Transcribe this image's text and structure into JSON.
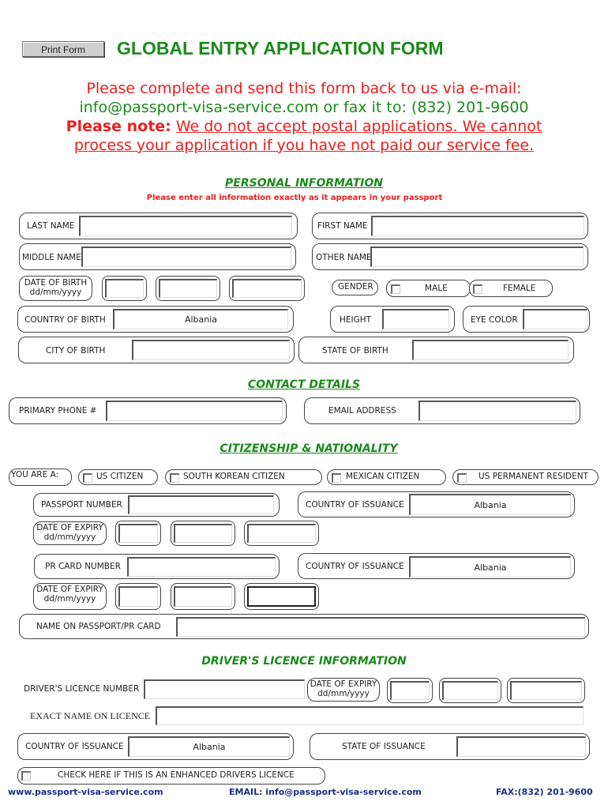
{
  "header": {
    "print_button": "Print Form",
    "title": "GLOBAL ENTRY APPLICATION FORM"
  },
  "notice": {
    "line1": "Please complete and send this form back to us via e-mail:",
    "line2": "info@passport-visa-service.com or fax it to:  (832) 201-9600",
    "note_label": "Please note:",
    "note_text_a": "We do not accept postal applications. We cannot",
    "note_text_b": "process your application if you have not paid our service fee."
  },
  "personal": {
    "title": "PERSONAL INFORMATION",
    "note": "Please enter all information exactly as it appears in your passport",
    "last_name": "LAST NAME",
    "first_name": "FIRST NAME",
    "middle_name": "MIDDLE NAME",
    "other_name": "OTHER NAME",
    "dob_line1": "DATE OF BIRTH",
    "dob_line2": "dd/mm/yyyy",
    "gender": "GENDER",
    "male": "MALE",
    "female": "FEMALE",
    "country_of_birth": "COUNTRY OF BIRTH",
    "country_of_birth_value": "Albania",
    "height": "HEIGHT",
    "eye_color": "EYE COLOR",
    "city_of_birth": "CITY OF BIRTH",
    "state_of_birth": "STATE OF BIRTH"
  },
  "contact": {
    "title": "CONTACT DETAILS",
    "phone": "PRIMARY PHONE #",
    "email": "EMAIL ADDRESS"
  },
  "citizenship": {
    "title": "CITIZENSHIP & NATIONALITY",
    "you_are": "YOU ARE A:",
    "options": [
      "US CITIZEN",
      "SOUTH KOREAN CITIZEN",
      "MEXICAN CITIZEN",
      "US PERMANENT RESIDENT"
    ],
    "passport_number": "PASSPORT NUMBER",
    "country_of_issuance": "COUNTRY OF ISSUANCE",
    "country_value": "Albania",
    "expiry_line1": "DATE OF EXPIRY",
    "expiry_line2": "dd/mm/yyyy",
    "pr_card_number": "PR CARD NUMBER",
    "pr_country_value": "Albania",
    "name_on_card": "NAME ON PASSPORT/PR CARD"
  },
  "licence": {
    "title": "DRIVER'S LICENCE INFORMATION",
    "number": "DRIVER'S LICENCE NUMBER",
    "expiry_line1": "DATE OF EXPIRY",
    "expiry_line2": "dd/mm/yyyy",
    "exact_name": "EXACT NAME ON LICENCE",
    "country_of_issuance": "COUNTRY OF ISSUANCE",
    "country_value": "Albania",
    "state_of_issuance": "STATE OF ISSUANCE",
    "enhanced": "CHECK HERE IF THIS IS AN ENHANCED DRIVERS LICENCE"
  },
  "footer": {
    "website": "www.passport-visa-service.com",
    "email": "EMAIL: info@passport-visa-service.com",
    "fax": "FAX:(832) 201-9600"
  }
}
